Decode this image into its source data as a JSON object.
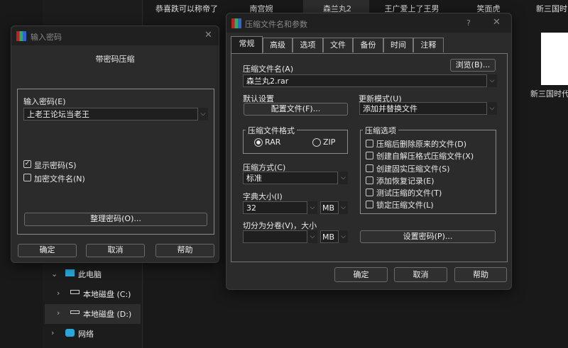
{
  "explorer": {
    "files": [
      "恭喜跌可以称帝了",
      "南宫婉",
      "森兰丸2",
      "王广爱上了王男",
      "笑面虎",
      "新三国时",
      "新三国时代出"
    ],
    "tree": [
      {
        "label": "此电脑"
      },
      {
        "label": "本地磁盘 (C:)"
      },
      {
        "label": "本地磁盘 (D:)"
      },
      {
        "label": "网络"
      }
    ]
  },
  "pwd": {
    "title": "输入密码",
    "heading": "带密码压缩",
    "label": "输入密码(E)",
    "value": "上老王论坛当老王",
    "show": "显示密码(S)",
    "show_checked": true,
    "encrypt": "加密文件名(N)",
    "encrypt_checked": false,
    "organize": "整理密码(O)...",
    "ok": "确定",
    "cancel": "取消",
    "help": "帮助"
  },
  "main": {
    "title": "压缩文件名和参数",
    "help": "?",
    "tabs": [
      "常规",
      "高级",
      "选项",
      "文件",
      "备份",
      "时间",
      "注释"
    ],
    "archive_label": "压缩文件名(A)",
    "browse": "浏览(B)...",
    "archive_value": "森兰丸2.rar",
    "default_label": "默认设置",
    "profiles": "配置文件(F)...",
    "update_label": "更新模式(U)",
    "update_value": "添加并替换文件",
    "format_label": "压缩文件格式",
    "rar": "RAR",
    "zip": "ZIP",
    "method_label": "压缩方式(C)",
    "method_value": "标准",
    "dict_label": "字典大小(I)",
    "dict_value": "32",
    "dict_unit": "MB",
    "split_label": "切分为分卷(V)，大小",
    "split_value": "",
    "split_unit": "MB",
    "options_label": "压缩选项",
    "options": [
      "压缩后删除原来的文件(D)",
      "创建自解压格式压缩文件(X)",
      "创建固实压缩文件(S)",
      "添加恢复记录(E)",
      "测试压缩的文件(T)",
      "锁定压缩文件(L)"
    ],
    "setpwd": "设置密码(P)...",
    "ok": "确定",
    "cancel": "取消",
    "helpbtn": "帮助"
  }
}
